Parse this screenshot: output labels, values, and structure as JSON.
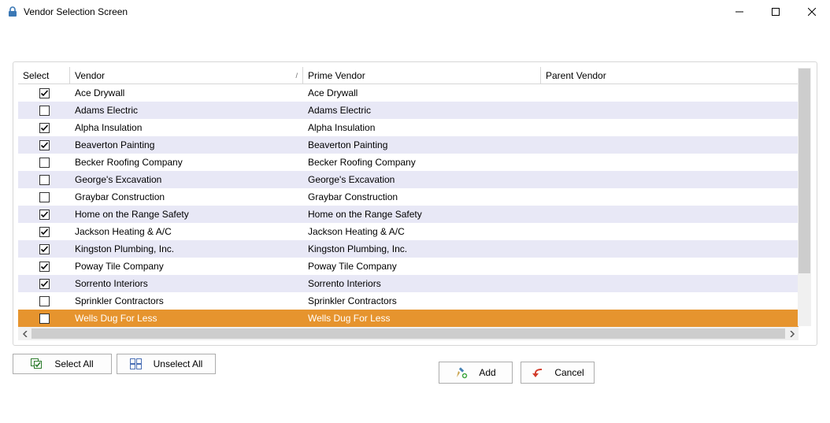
{
  "window": {
    "title": "Vendor Selection Screen"
  },
  "grid": {
    "headers": {
      "select": "Select",
      "vendor": "Vendor",
      "prime": "Prime Vendor",
      "parent": "Parent Vendor",
      "sort_indicator": "/"
    },
    "rows": [
      {
        "checked": true,
        "vendor": "Ace Drywall",
        "prime": "Ace Drywall",
        "parent": "",
        "alt": false,
        "highlight": false
      },
      {
        "checked": false,
        "vendor": "Adams Electric",
        "prime": "Adams Electric",
        "parent": "",
        "alt": true,
        "highlight": false
      },
      {
        "checked": true,
        "vendor": "Alpha Insulation",
        "prime": "Alpha Insulation",
        "parent": "",
        "alt": false,
        "highlight": false
      },
      {
        "checked": true,
        "vendor": "Beaverton Painting",
        "prime": "Beaverton Painting",
        "parent": "",
        "alt": true,
        "highlight": false
      },
      {
        "checked": false,
        "vendor": "Becker Roofing Company",
        "prime": "Becker Roofing Company",
        "parent": "",
        "alt": false,
        "highlight": false
      },
      {
        "checked": false,
        "vendor": "George's Excavation",
        "prime": "George's Excavation",
        "parent": "",
        "alt": true,
        "highlight": false
      },
      {
        "checked": false,
        "vendor": "Graybar Construction",
        "prime": "Graybar Construction",
        "parent": "",
        "alt": false,
        "highlight": false
      },
      {
        "checked": true,
        "vendor": "Home on the Range Safety",
        "prime": "Home on the Range Safety",
        "parent": "",
        "alt": true,
        "highlight": false
      },
      {
        "checked": true,
        "vendor": "Jackson Heating & A/C",
        "prime": "Jackson Heating & A/C",
        "parent": "",
        "alt": false,
        "highlight": false
      },
      {
        "checked": true,
        "vendor": "Kingston Plumbing, Inc.",
        "prime": "Kingston Plumbing, Inc.",
        "parent": "",
        "alt": true,
        "highlight": false
      },
      {
        "checked": true,
        "vendor": "Poway Tile Company",
        "prime": "Poway Tile Company",
        "parent": "",
        "alt": false,
        "highlight": false
      },
      {
        "checked": true,
        "vendor": "Sorrento Interiors",
        "prime": "Sorrento Interiors",
        "parent": "",
        "alt": true,
        "highlight": false
      },
      {
        "checked": false,
        "vendor": "Sprinkler Contractors",
        "prime": "Sprinkler Contractors",
        "parent": "",
        "alt": false,
        "highlight": false
      },
      {
        "checked": false,
        "vendor": "Wells Dug For Less",
        "prime": "Wells Dug For Less",
        "parent": "",
        "alt": false,
        "highlight": true
      }
    ]
  },
  "buttons": {
    "select_all": "Select All",
    "unselect_all": "Unselect All",
    "add": "Add",
    "cancel": "Cancel"
  }
}
